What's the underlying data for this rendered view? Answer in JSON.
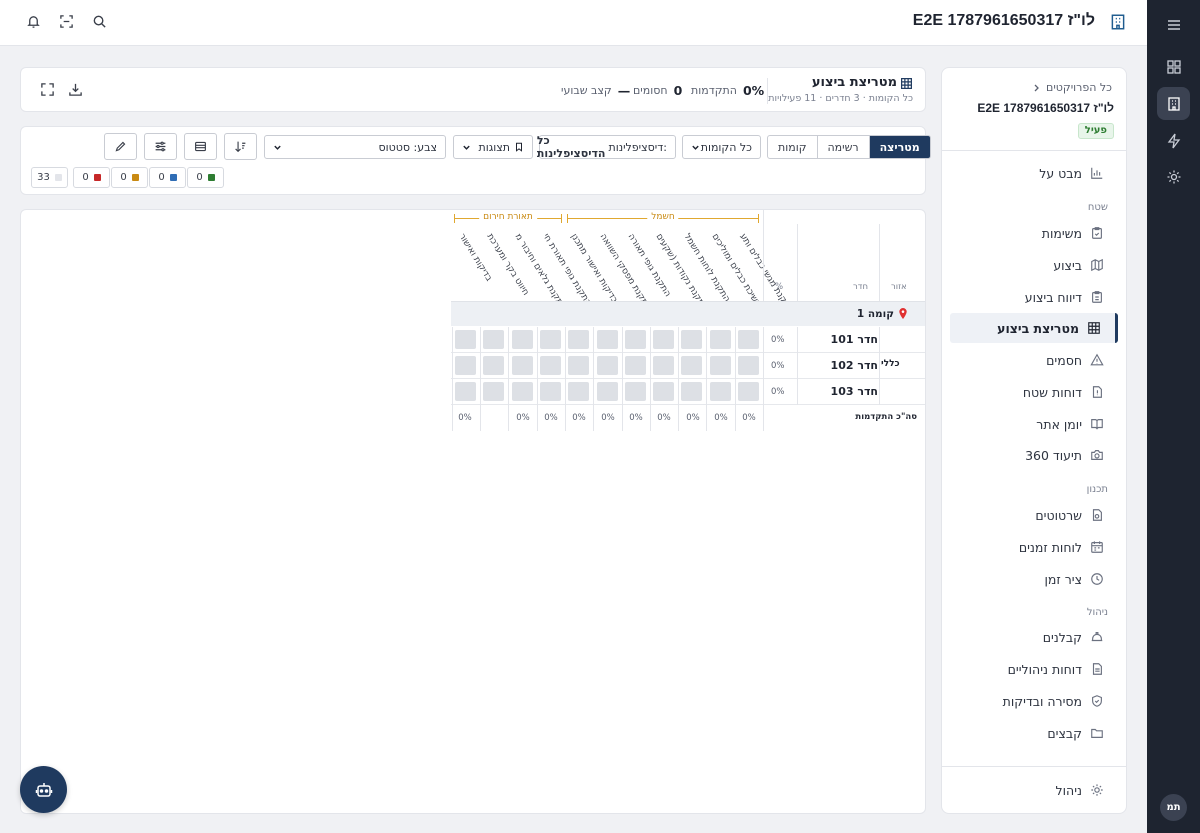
{
  "topbar": {
    "title": "E2E לו\"ז 1787961650317",
    "icons": [
      "building-icon",
      "search-icon",
      "scan-icon",
      "bell-icon"
    ]
  },
  "rail": {
    "icons": [
      "menu-icon",
      "dashboard-icon",
      "building-icon",
      "lightning-icon",
      "gear-icon"
    ],
    "avatar": "תמ"
  },
  "sidebar": {
    "back_label": "כל הפרויקטים",
    "project_name": "E2E לו\"ז 1787961650317",
    "status_badge": "פעיל",
    "items": [
      {
        "label": "מבט על",
        "icon": "chart-icon"
      },
      {
        "label": "משימות",
        "icon": "clipboard-icon"
      },
      {
        "label": "ביצוע",
        "icon": "map-icon"
      },
      {
        "label": "דיווח ביצוע",
        "icon": "report-icon"
      },
      {
        "label": "מטריצת ביצוע",
        "icon": "grid-icon"
      },
      {
        "label": "חסמים",
        "icon": "warning-icon"
      },
      {
        "label": "דוחות שטח",
        "icon": "file-alert-icon"
      },
      {
        "label": "יומן אתר",
        "icon": "book-icon"
      },
      {
        "label": "תיעוד 360",
        "icon": "camera-icon"
      },
      {
        "label": "שרטוטים",
        "icon": "blueprint-icon"
      },
      {
        "label": "לוחות זמנים",
        "icon": "calendar-icon"
      },
      {
        "label": "ציר זמן",
        "icon": "clock-icon"
      },
      {
        "label": "קבלנים",
        "icon": "hardhat-icon"
      },
      {
        "label": "דוחות ניהוליים",
        "icon": "document-icon"
      },
      {
        "label": "מסירה ובדיקות",
        "icon": "shield-icon"
      },
      {
        "label": "קבצים",
        "icon": "folder-icon"
      },
      {
        "label": "ניהול",
        "icon": "gear-icon"
      }
    ],
    "sections": {
      "field": "שטח",
      "planning": "תכנון",
      "management": "ניהול"
    }
  },
  "header": {
    "title": "מטריצת ביצוע",
    "subtitle": "כל הקומות · 3 חדרים · 11 פעילויות",
    "progress_value": "0%",
    "progress_label": "התקדמות",
    "blockers_value": "0",
    "blockers_label": "חסומים",
    "weekly_value": "—",
    "weekly_label": "קצב שבועי"
  },
  "toolbar": {
    "view_tabs": [
      "מטריצה",
      "רשימה",
      "קומות"
    ],
    "active_view": "מטריצה",
    "floors_select": "כל הקומות",
    "discipline_prefix": "דיסציפלינות:",
    "discipline_value": "כל הדיסציפלינות",
    "views_label": "תצוגות",
    "color_select": "צבע: סטטוס",
    "legend_chips": [
      {
        "count": "0",
        "color": "#2e7d32"
      },
      {
        "count": "0",
        "color": "#2f6db5"
      },
      {
        "count": "0",
        "color": "#c98a12"
      },
      {
        "count": "0",
        "color": "#c62828"
      },
      {
        "count": "33",
        "color": "#e3e5ea"
      }
    ]
  },
  "matrix": {
    "groups": [
      {
        "label": "חשמל"
      },
      {
        "label": "תאורת חירום"
      }
    ],
    "col_region": "אזור",
    "col_room": "חדר",
    "col_pct": "%",
    "activities": [
      "התקנת מגשי כבלים ותע...",
      "משיכת כבלים ומוליכים",
      "התקנת לוחות חשמל",
      "התקנת נקודות (שקעים...",
      "התקנת גופי תאורה",
      "התקנת מפסקי השוואה...",
      "בדיקות ואישור מתכנן",
      "התקנת גופי תאורת חי...",
      "התקנת גלאים וחיבור מ...",
      "חיווט בקר ומערכת",
      "בדיקות ואישור"
    ],
    "floor": "קומה 1",
    "region": "כללי",
    "rooms": [
      {
        "name": "חדר 101",
        "pct": "0%"
      },
      {
        "name": "חדר 102",
        "pct": "0%"
      },
      {
        "name": "חדר 103",
        "pct": "0%"
      }
    ],
    "totals_label": "סה\"כ התקדמות",
    "totals": [
      "0%",
      "0%",
      "0%",
      "0%",
      "0%",
      "0%",
      "0%",
      "0%",
      "0%",
      "0%"
    ]
  }
}
